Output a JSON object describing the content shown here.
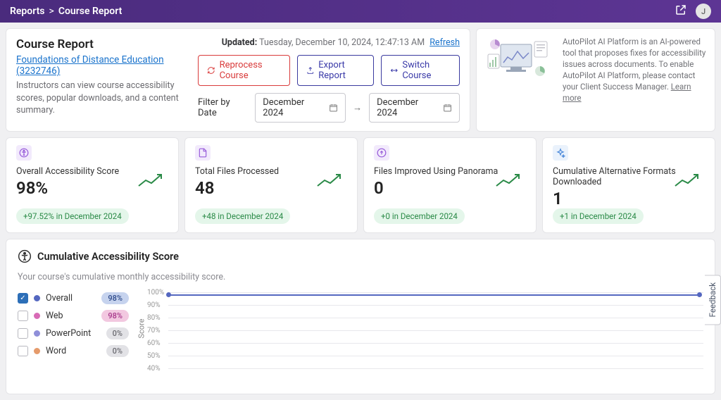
{
  "breadcrumb": {
    "root": "Reports",
    "page": "Course Report"
  },
  "avatar_initial": "J",
  "header": {
    "title": "Course Report",
    "course_link": "Foundations of Distance Education (3232746)",
    "description": "Instructors can view course accessibility scores, popular downloads, and a content summary.",
    "updated_label": "Updated:",
    "updated_time": "Tuesday, December 10, 2024, 12:47:13 AM",
    "refresh": "Refresh",
    "reprocess": "Reprocess Course",
    "export": "Export Report",
    "switch": "Switch Course",
    "filter_label": "Filter by Date",
    "date_from": "December 2024",
    "date_to": "December 2024"
  },
  "ai": {
    "text": "AutoPilot AI Platform is an AI-powered tool that proposes fixes for accessibility issues across documents. To enable AutoPilot AI Platform, please contact your Client Success Manager. ",
    "learn_more": "Learn more"
  },
  "stats": [
    {
      "label": "Overall Accessibility Score",
      "value": "98%",
      "badge": "+97.52% in December 2024"
    },
    {
      "label": "Total Files Processed",
      "value": "48",
      "badge": "+48 in December 2024"
    },
    {
      "label": "Files Improved Using Panorama",
      "value": "0",
      "badge": "+0 in December 2024"
    },
    {
      "label": "Cumulative Alternative Formats Downloaded",
      "value": "1",
      "badge": "+1 in December 2024"
    }
  ],
  "chart": {
    "title": "Cumulative Accessibility Score",
    "subtitle": "Your course's cumulative monthly accessibility score.",
    "ylabel": "Score",
    "legend": [
      {
        "name": "Overall",
        "pct": "98%",
        "color": "#5467c0",
        "checked": true,
        "pill": "navy"
      },
      {
        "name": "Web",
        "pct": "98%",
        "color": "#d86bb6",
        "checked": false,
        "pill": "pink"
      },
      {
        "name": "PowerPoint",
        "pct": "0%",
        "color": "#8f8fd9",
        "checked": false,
        "pill": "gray"
      },
      {
        "name": "Word",
        "pct": "0%",
        "color": "#e59b6b",
        "checked": false,
        "pill": "gray"
      }
    ]
  },
  "chart_data": {
    "type": "line",
    "title": "Cumulative Accessibility Score",
    "ylabel": "Score",
    "ylim": [
      0,
      100
    ],
    "y_ticks": [
      100,
      90,
      80,
      70,
      60,
      50,
      40
    ],
    "series": [
      {
        "name": "Overall",
        "values": [
          98,
          98
        ]
      }
    ]
  },
  "feedback": "Feedback"
}
